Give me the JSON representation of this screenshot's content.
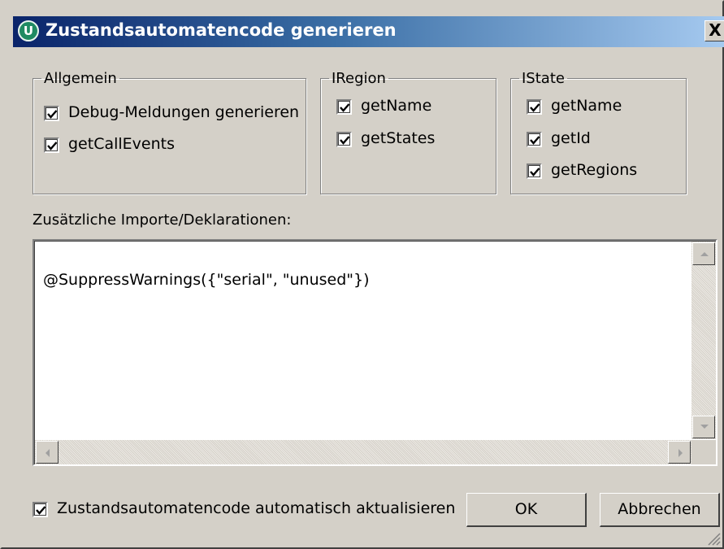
{
  "window": {
    "title": "Zustandsautomatencode generieren",
    "icon_name": "app-logo-icon",
    "icon_glyph": "U",
    "close_glyph": "X"
  },
  "groups": {
    "allgemein": {
      "title": "Allgemein",
      "items": [
        {
          "label": "Debug-Meldungen generieren",
          "checked": true
        },
        {
          "label": "getCallEvents",
          "checked": true
        }
      ]
    },
    "iregion": {
      "title": "IRegion",
      "items": [
        {
          "label": "getName",
          "checked": true
        },
        {
          "label": "getStates",
          "checked": true
        }
      ]
    },
    "istate": {
      "title": "IState",
      "items": [
        {
          "label": "getName",
          "checked": true
        },
        {
          "label": "getId",
          "checked": true
        },
        {
          "label": "getRegions",
          "checked": true
        }
      ]
    }
  },
  "imports": {
    "label": "Zusätzliche Importe/Deklarationen:",
    "value": "@SuppressWarnings({\"serial\", \"unused\"})"
  },
  "auto_update": {
    "label": "Zustandsautomatencode automatisch aktualisieren",
    "checked": true
  },
  "buttons": {
    "ok": "OK",
    "cancel": "Abbrechen"
  },
  "colors": {
    "dialog_bg": "#d4d0c8",
    "title_start": "#0a246a",
    "title_end": "#a6caf0"
  }
}
